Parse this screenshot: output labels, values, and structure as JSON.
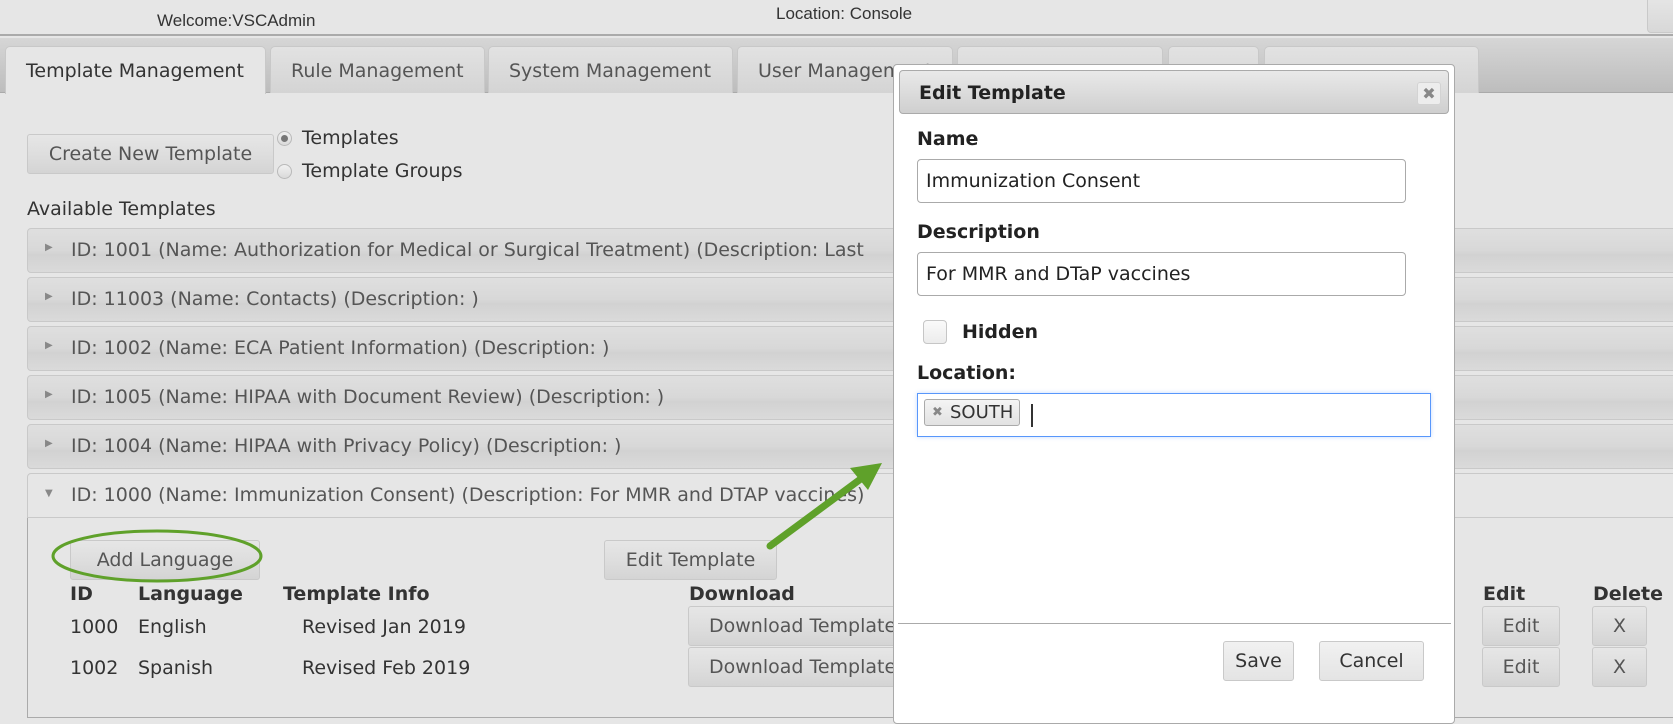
{
  "header": {
    "welcome": "Welcome:VSCAdmin",
    "location": "Location: Console"
  },
  "tabs": [
    {
      "label": "Template Management",
      "active": true
    },
    {
      "label": "Rule Management",
      "active": false
    },
    {
      "label": "System Management",
      "active": false
    },
    {
      "label": "User Management",
      "active": false
    },
    {
      "label": "",
      "active": false
    },
    {
      "label": "",
      "active": false
    },
    {
      "label": "",
      "active": false
    }
  ],
  "toolbar": {
    "create_button": "Create New Template",
    "radio_options": [
      {
        "label": "Templates",
        "checked": true
      },
      {
        "label": "Template Groups",
        "checked": false
      }
    ]
  },
  "available_templates": {
    "title": "Available Templates",
    "items": [
      {
        "text": "ID: 1001 (Name: Authorization for Medical or Surgical Treatment) (Description: Last",
        "expanded": false
      },
      {
        "text": "ID: 11003 (Name: Contacts) (Description: )",
        "expanded": false
      },
      {
        "text": "ID: 1002 (Name: ECA Patient Information) (Description: )",
        "expanded": false
      },
      {
        "text": "ID: 1005 (Name: HIPAA with Document Review) (Description: )",
        "expanded": false
      },
      {
        "text": "ID: 1004 (Name: HIPAA with Privacy Policy) (Description: )",
        "expanded": false
      },
      {
        "text": "ID: 1000 (Name: Immunization Consent) (Description: For MMR and DTAP vaccines)",
        "expanded": true
      }
    ],
    "expanded_panel": {
      "add_language_button": "Add Language",
      "edit_template_button": "Edit Template",
      "columns": [
        "ID",
        "Language",
        "Template Info",
        "Download",
        "Edit",
        "Delete"
      ],
      "rows": [
        {
          "id": "1000",
          "language": "English",
          "info": "Revised Jan 2019",
          "download": "Download Template",
          "edit": "Edit",
          "delete": "X"
        },
        {
          "id": "1002",
          "language": "Spanish",
          "info": "Revised Feb 2019",
          "download": "Download Template",
          "edit": "Edit",
          "delete": "X"
        }
      ]
    }
  },
  "dialog": {
    "title": "Edit Template",
    "close_icon": "close-icon",
    "name_label": "Name",
    "name_value": "Immunization Consent",
    "description_label": "Description",
    "description_value": "For MMR and DTaP vaccines",
    "hidden_label": "Hidden",
    "hidden_checked": false,
    "location_label": "Location:",
    "location_tags": [
      "SOUTH"
    ],
    "save_button": "Save",
    "cancel_button": "Cancel"
  },
  "annotations": {
    "color": "#5fa12a",
    "arrow": "points from Edit Template button to dialog",
    "ellipse": "highlights Add Language button"
  }
}
